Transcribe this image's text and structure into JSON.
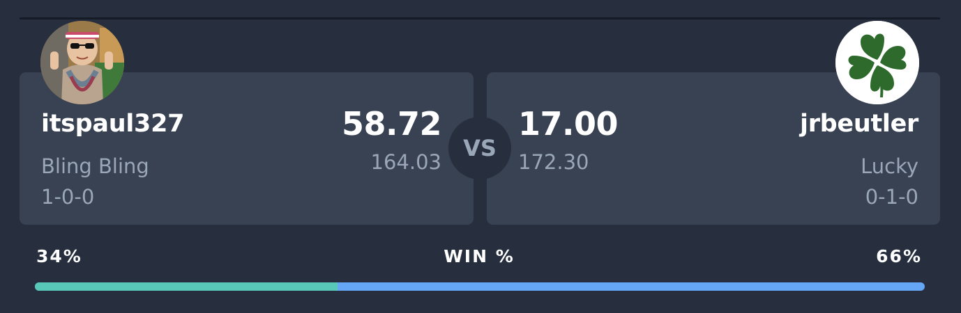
{
  "matchup": {
    "vs_label": "VS",
    "win_label": "WIN %",
    "home": {
      "team_name": "itspaul327",
      "nickname": "Bling Bling",
      "record": "1-0-0",
      "score": "58.72",
      "projected": "164.03",
      "win_pct_label": "34%",
      "win_pct": 0.34,
      "avatar": "kid-with-sunglasses-photo"
    },
    "away": {
      "team_name": "jrbeutler",
      "nickname": "Lucky",
      "record": "0-1-0",
      "score": "17.00",
      "projected": "172.30",
      "win_pct_label": "66%",
      "win_pct": 0.66,
      "avatar": "four-leaf-clover-icon"
    }
  },
  "colors": {
    "background": "#272f3f",
    "card": "#394252",
    "home_bar": "#58c8b8",
    "away_bar": "#66a7f5",
    "clover": "#2d6a2b"
  }
}
